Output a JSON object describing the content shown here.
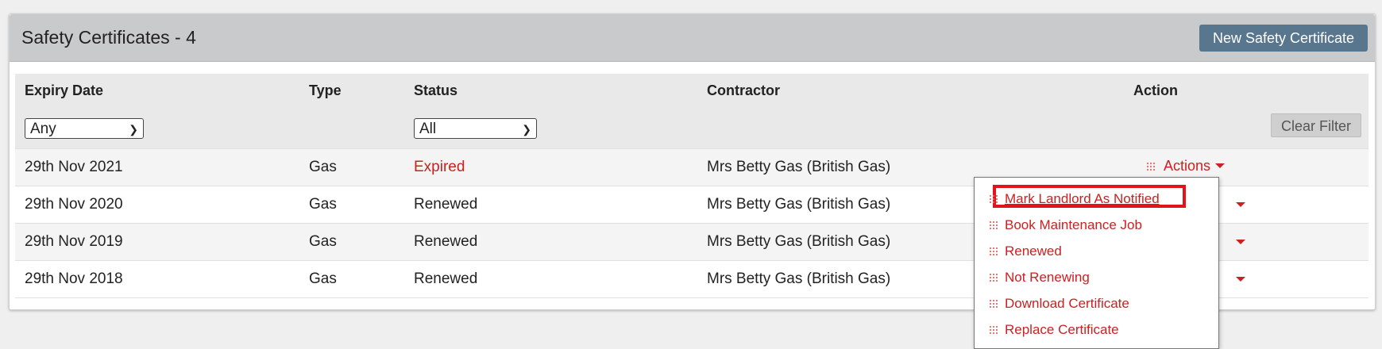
{
  "panel": {
    "title": "Safety Certificates - 4",
    "new_button": "New Safety Certificate"
  },
  "table": {
    "headers": {
      "expiry": "Expiry Date",
      "type": "Type",
      "status": "Status",
      "contractor": "Contractor",
      "action": "Action"
    },
    "filters": {
      "expiry_selected": "Any",
      "status_selected": "All",
      "clear_label": "Clear Filter"
    },
    "rows": [
      {
        "expiry": "29th Nov 2021",
        "type": "Gas",
        "status": "Expired",
        "contractor": "Mrs Betty Gas (British Gas)"
      },
      {
        "expiry": "29th Nov 2020",
        "type": "Gas",
        "status": "Renewed",
        "contractor": "Mrs Betty Gas (British Gas)"
      },
      {
        "expiry": "29th Nov 2019",
        "type": "Gas",
        "status": "Renewed",
        "contractor": "Mrs Betty Gas (British Gas)"
      },
      {
        "expiry": "29th Nov 2018",
        "type": "Gas",
        "status": "Renewed",
        "contractor": "Mrs Betty Gas (British Gas)"
      }
    ],
    "actions_label": "Actions"
  },
  "menu": {
    "items": [
      "Mark Landlord As Notified",
      "Book Maintenance Job",
      "Renewed",
      "Not Renewing",
      "Download Certificate",
      "Replace Certificate"
    ]
  },
  "colors": {
    "header_bg": "#c9cacb",
    "primary_button": "#58768e",
    "accent_red": "#cc1f1f",
    "highlight_border": "#e0141a"
  },
  "icons": {
    "drag_handle": "grip-icon",
    "dropdown": "caret-down-icon"
  }
}
